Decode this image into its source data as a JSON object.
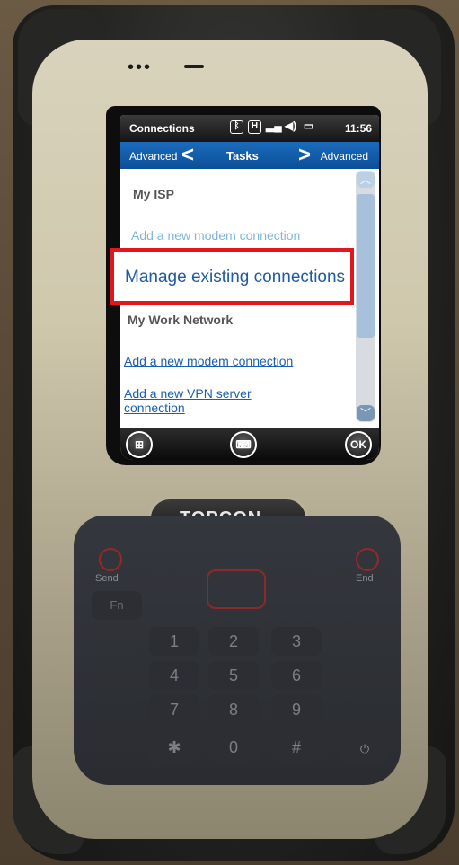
{
  "device": {
    "brand": "TOPCON"
  },
  "statusbar": {
    "title": "Connections",
    "bluetooth_icon": "bluetooth-icon",
    "h_icon": "H",
    "signal_icon": "signal-icon",
    "volume_icon": "volume-icon",
    "battery_icon": "battery-icon",
    "time": "11:56"
  },
  "tabs": {
    "left": "Advanced",
    "left_chevron": "<",
    "center": "Tasks",
    "right_chevron": ">",
    "right": "Advanced"
  },
  "content": {
    "section1_title": "My ISP",
    "section1_link": "Add a new modem connection",
    "section2_title": "My Work Network",
    "section2_link1": "Add a new modem connection",
    "section2_link2_line1": "Add a new VPN server",
    "section2_link2_line2": "connection"
  },
  "highlight": {
    "label": "Manage existing connections",
    "border_color": "#e3161e"
  },
  "softkeys": {
    "ok": "OK"
  },
  "keypad": {
    "send": "Send",
    "end": "End",
    "fn": "Fn",
    "k1": "1",
    "k2": "2",
    "k3": "3",
    "k4": "4",
    "k5": "5",
    "k6": "6",
    "k7": "7",
    "k8": "8",
    "k9": "9",
    "k0": "0",
    "star": "✱",
    "hash": "#"
  }
}
